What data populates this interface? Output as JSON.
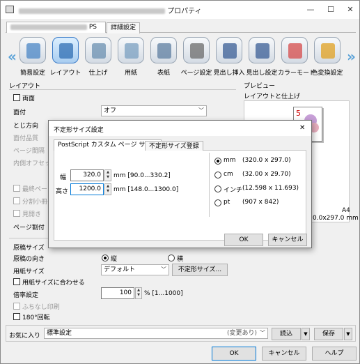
{
  "window": {
    "title_suffix": "プロパティ",
    "minimize": "—",
    "maximize": "☐",
    "close": "✕"
  },
  "tabs": {
    "ps": "PS",
    "advanced": "詳細設定"
  },
  "toolbar": [
    {
      "label": "簡易設定",
      "icon": "quick-setting-icon"
    },
    {
      "label": "レイアウト",
      "icon": "layout-icon",
      "selected": true
    },
    {
      "label": "仕上げ",
      "icon": "finishing-icon"
    },
    {
      "label": "用紙",
      "icon": "paper-icon"
    },
    {
      "label": "表紙",
      "icon": "cover-icon"
    },
    {
      "label": "ページ設定",
      "icon": "page-setting-icon"
    },
    {
      "label": "見出し挿入",
      "icon": "tab-insert-icon"
    },
    {
      "label": "見出し設定",
      "icon": "tab-setting-icon"
    },
    {
      "label": "カラーモード",
      "icon": "color-mode-icon"
    },
    {
      "label": "色変換設定",
      "icon": "color-conversion-icon"
    }
  ],
  "layout": {
    "group_label": "レイアウト",
    "duplex": "両面",
    "binding_label": "面付",
    "binding_value": "オフ",
    "direction": "とじ方向",
    "binding_quality": "面付品質",
    "page_margin": "ページ間隔",
    "inner_offset": "内側オフセット",
    "last_page": "最終ページ",
    "split": "分割小冊子",
    "spread": "見開き",
    "page_split": "ページ割付"
  },
  "original": {
    "size_label": "原稿サイズ",
    "orientation_label": "原稿の向き",
    "portrait": "縦",
    "landscape": "横",
    "paper_size_label": "用紙サイズ",
    "paper_size_value": "デフォルト",
    "custom_size_button": "不定形サイズ...",
    "fit_paper": "用紙サイズに合わせる",
    "scale_label": "倍率設定",
    "scale_value": "100",
    "scale_range": "% [1...1000]",
    "borderless": "ふちなし印刷",
    "rotate": "180°回転"
  },
  "preview": {
    "label": "プレビュー",
    "sublabel": "レイアウトと仕上げ",
    "paper_name": "A4",
    "paper_dims": "0.0x297.0 mm"
  },
  "favorites": {
    "label": "お気に入り",
    "value": "標準設定",
    "modified": "(変更あり)",
    "load_button": "読込",
    "save_button": "保存"
  },
  "footer": {
    "ok": "OK",
    "cancel": "キャンセル",
    "help": "ヘルプ"
  },
  "dialog": {
    "title": "不定形サイズ設定",
    "close": "✕",
    "tab_active": "PostScript カスタム ページ サイズ",
    "tab_other": "不定形サイズ登録",
    "width_label": "幅",
    "width_value": "320.0",
    "width_range": "mm [90.0...330.2]",
    "height_label": "高さ",
    "height_value": "1200.0",
    "height_range": "mm [148.0...1300.0]",
    "units": [
      {
        "label": "mm",
        "value": "(320.0 x 297.0)",
        "selected": true
      },
      {
        "label": "cm",
        "value": "(32.00 x 29.70)"
      },
      {
        "label": "インチ",
        "value": "(12.598 x 11.693)"
      },
      {
        "label": "pt",
        "value": "(907 x 842)"
      }
    ],
    "ok": "OK",
    "cancel": "キャンセル"
  }
}
